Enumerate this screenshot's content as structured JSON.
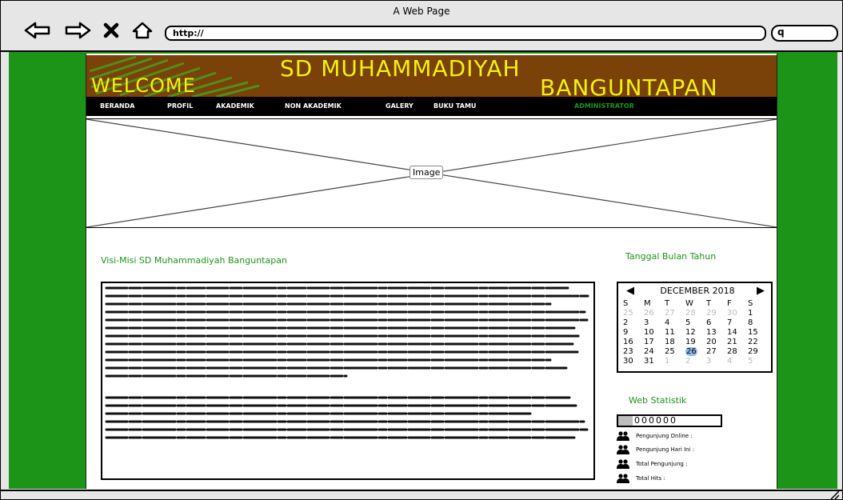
{
  "window": {
    "title": "A Web Page"
  },
  "browser": {
    "url": "http://"
  },
  "banner": {
    "welcome": "WELCOME",
    "school_line1": "SD MUHAMMADIYAH",
    "school_line2": "BANGUNTAPAN"
  },
  "menu": {
    "items": [
      "BERANDA",
      "PROFIL",
      "AKADEMIK",
      "NON AKADEMIK",
      "GALERY",
      "BUKU TAMU"
    ],
    "admin": "ADMINISTRATOR"
  },
  "hero": {
    "label": "Image"
  },
  "main": {
    "heading": "Visi-Misi SD Muhammadiyah Banguntapan"
  },
  "sidebar": {
    "date_heading": "Tanggal Bulan Tahun",
    "stats_heading": "Web Statistik",
    "counter": "000000",
    "stats": [
      "Pengunjung Online :",
      "Pengunjung Hari Ini :",
      "Total Pengunjung :",
      "Total Hits :"
    ]
  },
  "calendar": {
    "month_label": "DECEMBER 2018",
    "prev": "◀",
    "next": "▶",
    "weekdays": [
      "S",
      "M",
      "T",
      "W",
      "T",
      "F",
      "S"
    ],
    "weeks": [
      [
        [
          "25",
          true
        ],
        [
          "26",
          true
        ],
        [
          "27",
          true
        ],
        [
          "28",
          true
        ],
        [
          "29",
          true
        ],
        [
          "30",
          true
        ],
        [
          "1",
          false
        ]
      ],
      [
        [
          "2",
          false
        ],
        [
          "3",
          false
        ],
        [
          "4",
          false
        ],
        [
          "5",
          false
        ],
        [
          "6",
          false
        ],
        [
          "7",
          false
        ],
        [
          "8",
          false
        ]
      ],
      [
        [
          "9",
          false
        ],
        [
          "10",
          false
        ],
        [
          "11",
          false
        ],
        [
          "12",
          false
        ],
        [
          "13",
          false
        ],
        [
          "14",
          false
        ],
        [
          "15",
          false
        ]
      ],
      [
        [
          "16",
          false
        ],
        [
          "17",
          false
        ],
        [
          "18",
          false
        ],
        [
          "19",
          false
        ],
        [
          "20",
          false
        ],
        [
          "21",
          false
        ],
        [
          "22",
          false
        ]
      ],
      [
        [
          "23",
          false
        ],
        [
          "24",
          false
        ],
        [
          "25",
          false
        ],
        [
          "26",
          false
        ],
        [
          "27",
          false
        ],
        [
          "28",
          false
        ],
        [
          "29",
          false
        ]
      ],
      [
        [
          "30",
          false
        ],
        [
          "31",
          false
        ],
        [
          "1",
          true
        ],
        [
          "2",
          true
        ],
        [
          "3",
          true
        ],
        [
          "4",
          true
        ],
        [
          "5",
          true
        ]
      ]
    ],
    "selected": "26"
  },
  "colors": {
    "accent_green": "#1c9418",
    "banner_brown": "#7a4108",
    "banner_text": "#f2f20c",
    "selected_day": "#8fb9ea"
  },
  "icons": [
    "back-arrow-icon",
    "forward-arrow-icon",
    "close-icon",
    "home-icon",
    "search-icon",
    "users-icon"
  ]
}
